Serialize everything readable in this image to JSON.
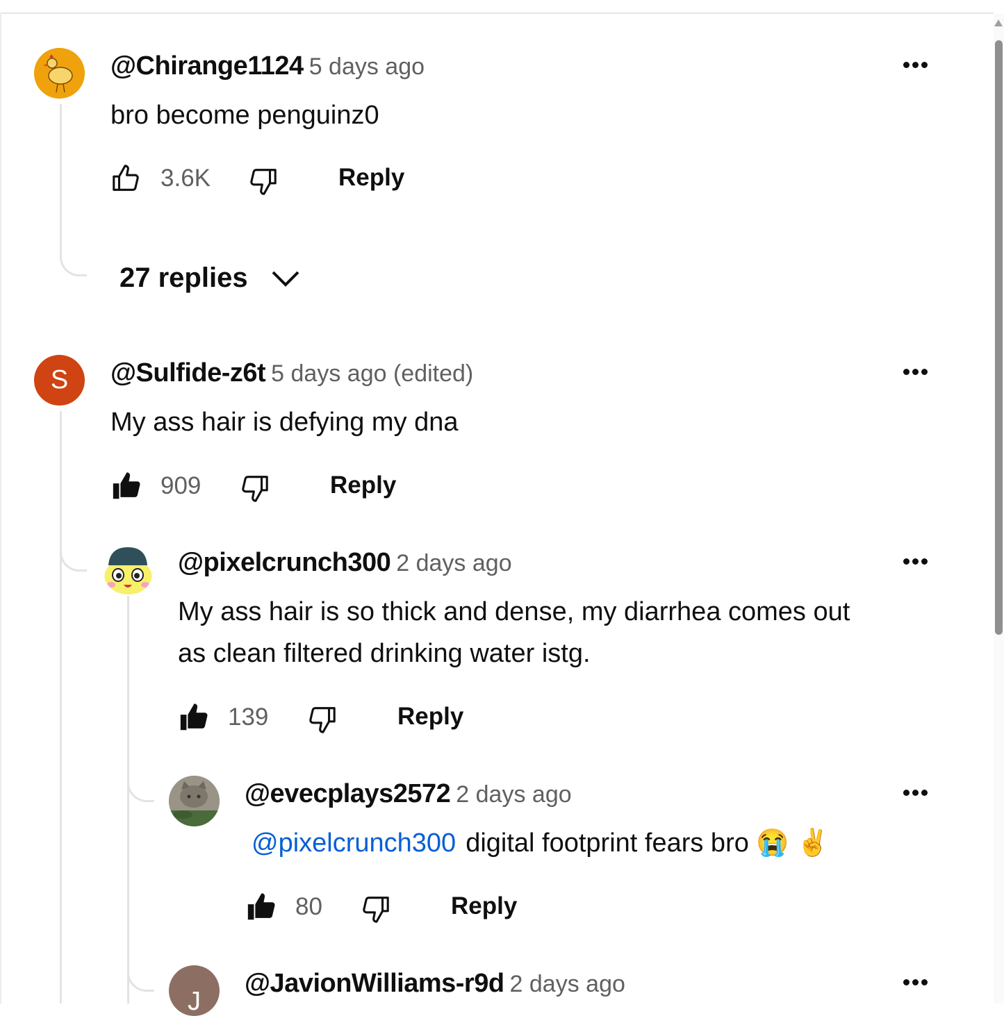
{
  "comments": [
    {
      "author": "@Chirange1124",
      "time": "5 days ago",
      "text": "bro become penguinz0",
      "likes": "3.6K",
      "reply_label": "Reply",
      "liked": false,
      "replies_label": "27 replies"
    },
    {
      "author": "@Sulfide-z6t",
      "time": "5 days ago (edited)",
      "avatar_letter": "S",
      "avatar_color": "#d04313",
      "text": "My ass hair is defying my dna",
      "likes": "909",
      "reply_label": "Reply",
      "liked": true
    },
    {
      "author": "@pixelcrunch300",
      "time": "2 days ago",
      "text_line1": "My ass hair is so thick and dense, my diarrhea comes out",
      "text_line2": "as clean filtered drinking water istg.",
      "likes": "139",
      "reply_label": "Reply",
      "liked": true
    },
    {
      "author": "@evecplays2572",
      "time": "2 days ago",
      "mention": "@pixelcrunch300",
      "text": "digital footprint fears bro 😭 ✌️",
      "likes": "80",
      "reply_label": "Reply",
      "liked": true
    },
    {
      "author": "@JavionWilliams-r9d",
      "time": "2 days ago",
      "avatar_letter": "J",
      "avatar_color": "#8d6e63"
    }
  ],
  "colors": {
    "mention": "#065fd4",
    "meta": "#606060",
    "text": "#0f0f0f"
  },
  "icons": [
    "thumb-up-icon",
    "thumb-down-icon",
    "more-vert-icon",
    "chevron-down-icon"
  ]
}
